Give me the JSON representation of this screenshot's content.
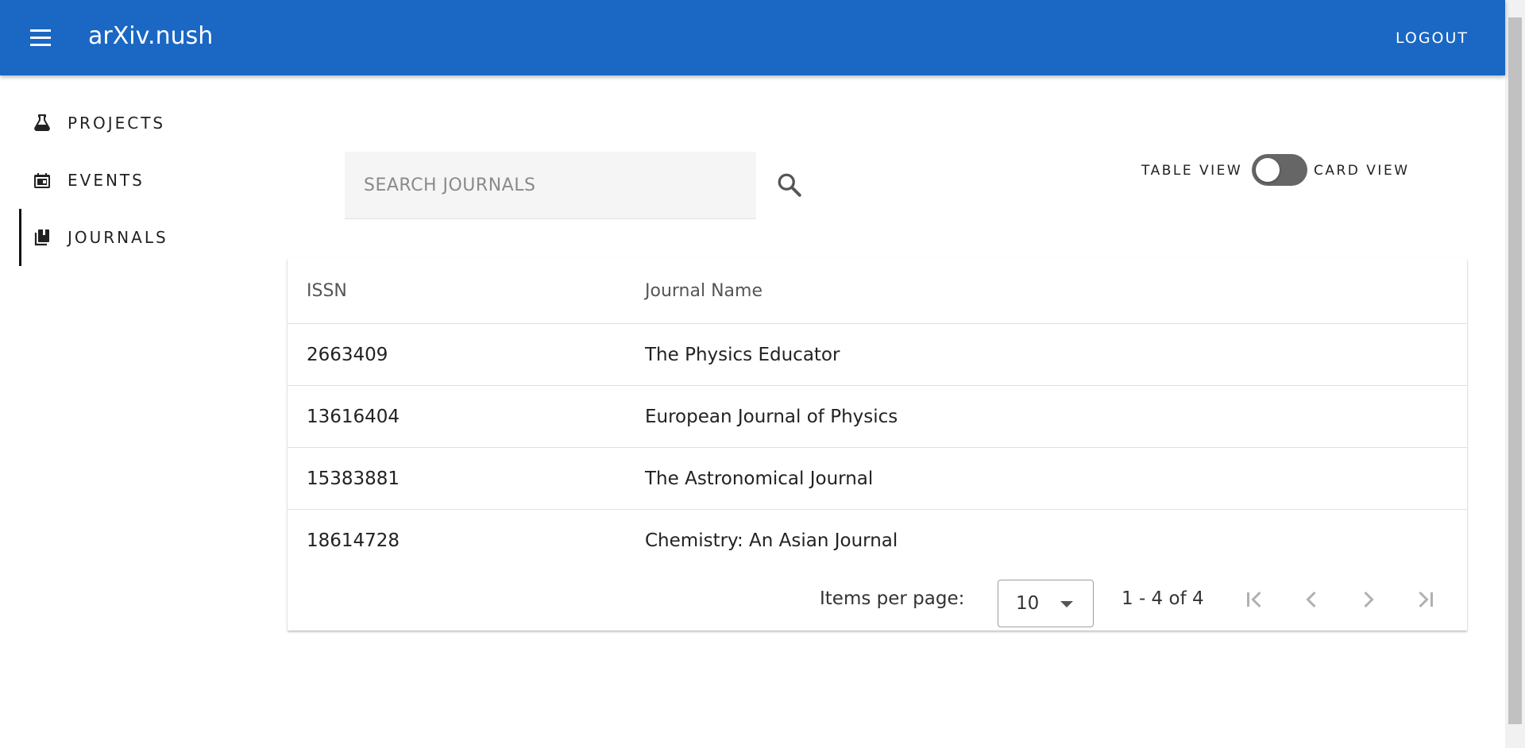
{
  "header": {
    "title": "arXiv.nush",
    "logout_label": "LOGOUT",
    "menu_icon": "menu-icon",
    "color": "#1a67c4"
  },
  "sidebar": {
    "items": [
      {
        "label": "PROJECTS",
        "icon": "flask-icon",
        "active": false
      },
      {
        "label": "EVENTS",
        "icon": "calendar-icon",
        "active": false
      },
      {
        "label": "JOURNALS",
        "icon": "books-icon",
        "active": true
      }
    ]
  },
  "search": {
    "placeholder": "SEARCH JOURNALS",
    "value": "",
    "icon": "search-icon"
  },
  "view_toggle": {
    "left_label": "TABLE VIEW",
    "right_label": "CARD VIEW",
    "state": "table"
  },
  "table": {
    "columns": [
      "ISSN",
      "Journal Name"
    ],
    "rows": [
      {
        "issn": "2663409",
        "name": "The Physics Educator"
      },
      {
        "issn": "13616404",
        "name": "European Journal of Physics"
      },
      {
        "issn": "15383881",
        "name": "The Astronomical Journal"
      },
      {
        "issn": "18614728",
        "name": "Chemistry: An Asian Journal"
      }
    ]
  },
  "paginator": {
    "items_per_page_label": "Items per page:",
    "page_size": "10",
    "range_label": "1 - 4 of 4",
    "buttons": [
      "first-page-icon",
      "previous-page-icon",
      "next-page-icon",
      "last-page-icon"
    ]
  }
}
